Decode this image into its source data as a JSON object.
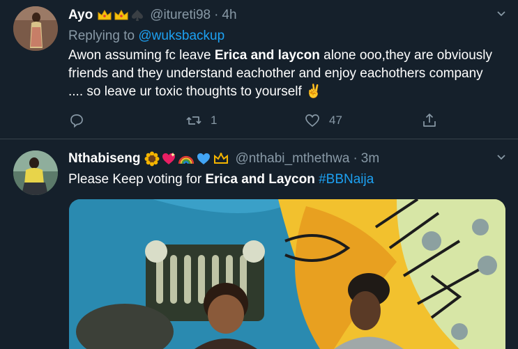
{
  "tweets": [
    {
      "display_name": "Ayo",
      "name_emoji": "👑👑♠",
      "handle": "@itureti98",
      "separator": "·",
      "time": "4h",
      "replying_prefix": "Replying to",
      "replying_to": "@wuksbackup",
      "text_part1": "Awon assuming fc leave ",
      "text_bold": "Erica and laycon",
      "text_part2": " alone ooo,they are obviously friends and they understand eachother and enjoy eachothers company .... so leave ur toxic thoughts to yourself ✌️",
      "retweets": "1",
      "likes": "47"
    },
    {
      "display_name": "Nthabiseng",
      "name_emoji": "🌻💖🌈💙👑",
      "handle": "@nthabi_mthethwa",
      "separator": "·",
      "time": "3m",
      "text_part1": "Please Keep voting for ",
      "text_bold": "Erica and Laycon",
      "text_part2": " ",
      "hashtag": "#BBNaija"
    }
  ],
  "icons": {
    "chevron": "chevron-down-icon",
    "reply": "reply-icon",
    "retweet": "retweet-icon",
    "like": "heart-icon",
    "share": "share-icon"
  },
  "colors": {
    "background": "#15202b",
    "secondary_text": "#8899a6",
    "link": "#1da1f2",
    "divider": "#38444d"
  }
}
